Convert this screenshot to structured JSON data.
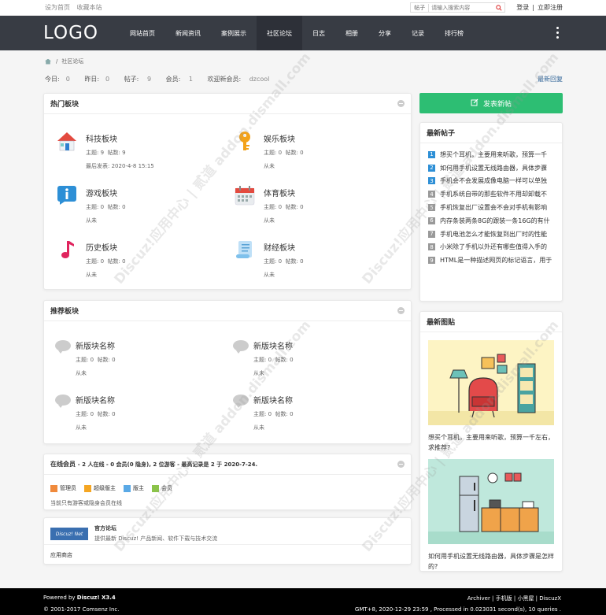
{
  "topbar": {
    "set_home": "设为首页",
    "bookmark": "收藏本站",
    "search_type": "帖子",
    "search_placeholder": "请输入搜索内容",
    "login": "登录",
    "sep": "|",
    "register": "立即注册"
  },
  "nav": {
    "logo": "LOGO",
    "items": [
      "网站首页",
      "新闻资讯",
      "案例展示",
      "社区论坛",
      "日志",
      "相册",
      "分享",
      "记录",
      "排行榜"
    ]
  },
  "breadcrumb": {
    "current": "社区论坛",
    "sep": "/"
  },
  "stats": {
    "today_label": "今日:",
    "today": "0",
    "yesterday_label": "昨日:",
    "yesterday": "0",
    "posts_label": "帖子:",
    "posts": "9",
    "members_label": "会员:",
    "members": "1",
    "welcome": "欢迎新会员:",
    "new_member": "dzcool",
    "latest_reply": "最新回复"
  },
  "hot": {
    "title": "热门板块",
    "forums": [
      {
        "name": "科技板块",
        "topics": "主题: 9",
        "posts": "帖数: 9",
        "last": "最后发表: 2020-4-8 15:15"
      },
      {
        "name": "娱乐板块",
        "topics": "主题: 0",
        "posts": "帖数: 0",
        "last": "从未"
      },
      {
        "name": "游戏板块",
        "topics": "主题: 0",
        "posts": "帖数: 0",
        "last": "从未"
      },
      {
        "name": "体育板块",
        "topics": "主题: 0",
        "posts": "帖数: 0",
        "last": "从未"
      },
      {
        "name": "历史板块",
        "topics": "主题: 0",
        "posts": "帖数: 0",
        "last": "从未"
      },
      {
        "name": "财经板块",
        "topics": "主题: 0",
        "posts": "帖数: 0",
        "last": "从未"
      }
    ]
  },
  "rec": {
    "title": "推荐板块",
    "forums": [
      {
        "name": "新版块名称",
        "topics": "主题: 0",
        "posts": "帖数: 0",
        "last": "从未"
      },
      {
        "name": "新版块名称",
        "topics": "主题: 0",
        "posts": "帖数: 0",
        "last": "从未"
      },
      {
        "name": "新版块名称",
        "topics": "主题: 0",
        "posts": "帖数: 0",
        "last": "从未"
      },
      {
        "name": "新版块名称",
        "topics": "主题: 0",
        "posts": "帖数: 0",
        "last": "从未"
      }
    ]
  },
  "online": {
    "title": "在线会员",
    "summary": "- 2 人在线 - 0 会员(0 隐身), 2 位游客 - 最高记录是 2 于 2020-7-24.",
    "legend": [
      "管理员",
      "超级版主",
      "版主",
      "会员"
    ],
    "legend_colors": [
      "#f08a3c",
      "#f5a623",
      "#5aa9e6",
      "#8bc34a"
    ],
    "note": "当前只有游客或隐身会员在线"
  },
  "links": {
    "logo_text": "Discuz! Net",
    "name": "官方论坛",
    "desc": "提供最新 Discuz! 产品新闻、软件下载与技术交流",
    "shop": "应用商店"
  },
  "post_button": "发表新帖",
  "latest": {
    "title": "最新帖子",
    "items": [
      "想买个耳机，主要用来听歌，预算一千",
      "如何用手机设置无线路由器，具体步骤",
      "手机会不会发展成像电脑一样可以单独",
      "手机系统自带的那些软件不用却卸载不",
      "手机恢复出厂设置会不会对手机有影响",
      "内存条装两条8G的跟装一条16G的有什",
      "手机电池怎么才能恢复到出厂时的性能",
      "小米除了手机以外还有哪些值得入手的",
      "HTML是一种描述网页的标记语言，用于"
    ],
    "nums": [
      "1",
      "2",
      "3",
      "4",
      "5",
      "6",
      "7",
      "8",
      "9"
    ],
    "num_hot": "#2d8fd6",
    "num_normal": "#999"
  },
  "pics": {
    "title": "最新图贴",
    "items": [
      {
        "caption": "想买个耳机，主要用来听歌，预算一千左右，求推荐?"
      },
      {
        "caption": "如何用手机设置无线路由器，具体步骤是怎样的?"
      }
    ]
  },
  "footer": {
    "powered_prefix": "Powered by ",
    "powered": "Discuz! X3.4",
    "copyright": "© 2001-2017 Comsenz Inc.",
    "links": "Archiver | 手机版 | 小黑屋 | DiscuzX",
    "stats": "GMT+8, 2020-12-29 23:59 , Processed in 0.023031 second(s), 10 queries ."
  },
  "watermark": "Discuz!应用中心 | 贰道 addon.dismall.com"
}
